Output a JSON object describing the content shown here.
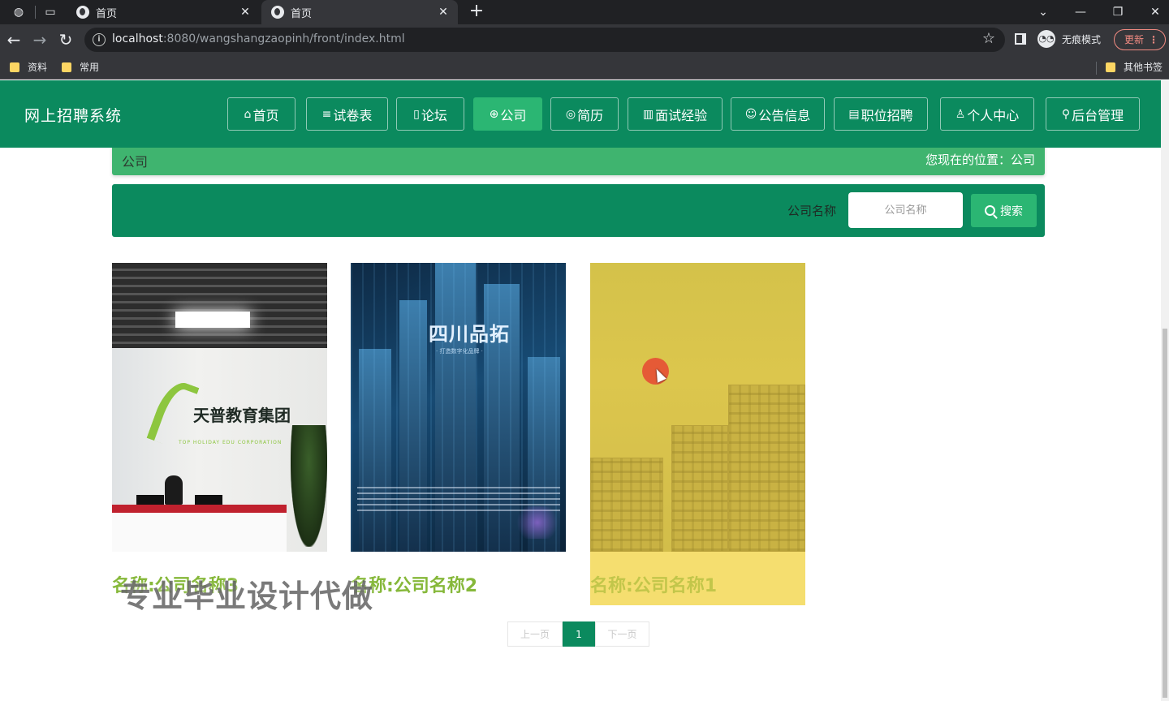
{
  "browser": {
    "tabs": [
      {
        "title": "首页",
        "close": "✕"
      },
      {
        "title": "首页",
        "close": "✕"
      }
    ],
    "new_tab": "+",
    "url_host": "localhost",
    "url_path": ":8080/wangshangzaopinh/front/index.html",
    "incognito_label": "无痕模式",
    "update_label": "更新",
    "bookmarks": [
      "资料",
      "常用"
    ],
    "other_bookmarks": "其他书签"
  },
  "site": {
    "title": "网上招聘系统",
    "nav": [
      {
        "label": "首页",
        "icon": "home-icon",
        "glyph": "⌂"
      },
      {
        "label": "试卷表",
        "icon": "list-icon",
        "glyph": "≡"
      },
      {
        "label": "论坛",
        "icon": "doc-icon",
        "glyph": "▯"
      },
      {
        "label": "公司",
        "icon": "globe-icon",
        "glyph": "⊕"
      },
      {
        "label": "简历",
        "icon": "palette-icon",
        "glyph": "◎"
      },
      {
        "label": "面试经验",
        "icon": "grid-icon",
        "glyph": "▥"
      },
      {
        "label": "公告信息",
        "icon": "smile-icon",
        "glyph": "☺"
      },
      {
        "label": "职位招聘",
        "icon": "form-icon",
        "glyph": "▤"
      },
      {
        "label": "个人中心",
        "icon": "user-icon",
        "glyph": "♙"
      },
      {
        "label": "后台管理",
        "icon": "link-icon",
        "glyph": "⚲"
      }
    ],
    "active_nav": "公司"
  },
  "breadcrumb": {
    "section": "公司",
    "location_label": "您现在的位置：公司"
  },
  "search": {
    "label": "公司名称",
    "placeholder": "公司名称",
    "button": "搜索"
  },
  "companies": [
    {
      "name": "名称:公司名称3",
      "image": "office-reception-photo",
      "logo_text": "天普教育集团",
      "logo_sub": "TOP HOLIDAY EDU CORPORATION"
    },
    {
      "name": "名称:公司名称2",
      "image": "city-skyline-photo",
      "logo_text": "四川品拓",
      "logo_sub": "· 打造数字化品牌 ·"
    },
    {
      "name": "名称:公司名称1",
      "image": "campus-building-photo"
    }
  ],
  "watermark": "专业毕业设计代做",
  "pagination": {
    "prev": "上一页",
    "current": "1",
    "next": "下一页"
  },
  "colors": {
    "header_green": "#0b8a5e",
    "accent_green": "#2bb673",
    "breadcrumb_green": "#3fb46f",
    "name_green": "#86b83a",
    "hover_yellow": "#f5de6f"
  }
}
